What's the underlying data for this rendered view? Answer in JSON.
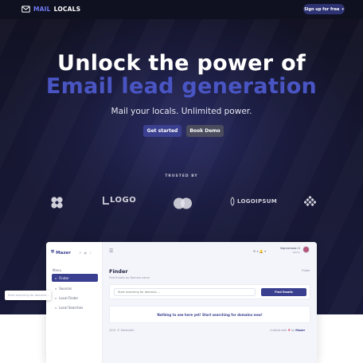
{
  "nav": {
    "logo_part1": "MAIL",
    "logo_part2": "LOCALS",
    "signup_label": "Sign up for free",
    "signup_chevron": "▾"
  },
  "hero": {
    "title_line1": "Unlock the power of",
    "title_line2": "Email lead generation",
    "subtitle": "Mail your locals. Unlimited power.",
    "primary_cta": "Get started",
    "secondary_cta": "Book Demo",
    "trusted_label": "TRUSTED BY"
  },
  "brands": [
    {
      "icon": "clover-icon",
      "text": ""
    },
    {
      "icon": "logo-box-icon",
      "text": "LOGO"
    },
    {
      "icon": "mastercard-icon",
      "text": ""
    },
    {
      "icon": "logoipsum-icon",
      "text": "LOGOIPSUM"
    },
    {
      "icon": "diamond-grid-icon",
      "text": ""
    }
  ],
  "dashboard": {
    "app_name": "Mazer",
    "sidebar_controls": "☼ ◐ ☾",
    "menu_label": "Menu",
    "sidebar_items": [
      {
        "label": "Finder",
        "active": true
      },
      {
        "label": "Sources",
        "active": false
      },
      {
        "label": "Local Finder",
        "active": false
      },
      {
        "label": "Local Searches",
        "active": false
      }
    ],
    "topbar_icons": "✉ ▾  🔔 ▾",
    "user_name": "Vignesharan S",
    "user_role": "Admin",
    "page_title": "Finder",
    "page_subtitle": "Find Emails by Domain name",
    "breadcrumb": "Finder",
    "search_placeholder": "Start searching for domains ...",
    "find_button": "Find Emails",
    "empty_message": "Nothing to see here yet! Start searching for domains now!",
    "footer_left": "2021 © Mailsmith",
    "footer_right_prefix": "Crafted with",
    "footer_heart": "♥",
    "footer_right_by": "by",
    "footer_right_brand": "Mazer"
  },
  "floating_search": {
    "placeholder": "Start searching for domains ..."
  },
  "colors": {
    "accent": "#3a3f8f",
    "brand_blue": "#4a55c4",
    "hero_bg": "#15162f"
  }
}
